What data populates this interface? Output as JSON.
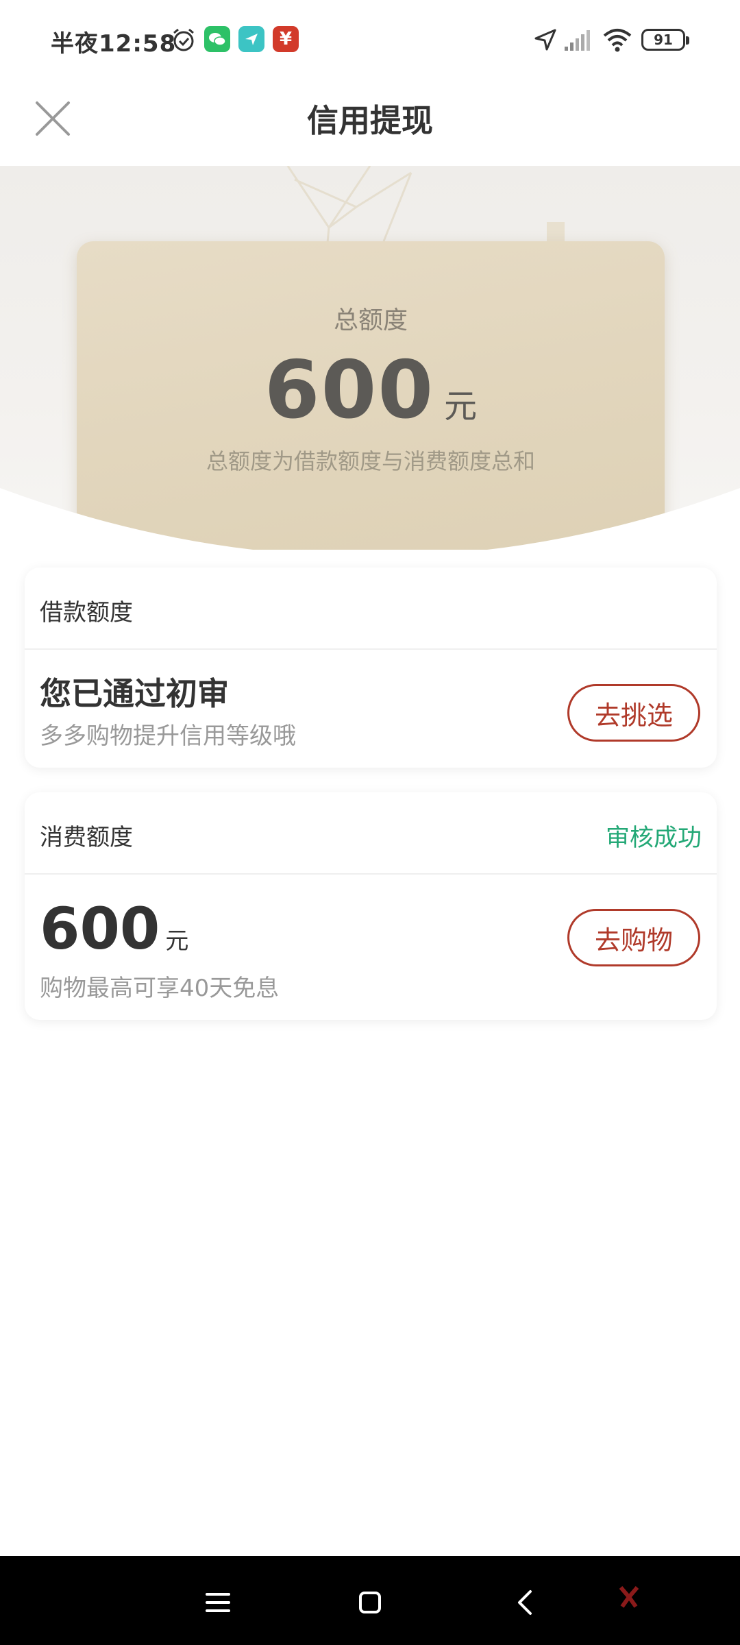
{
  "status_bar": {
    "time": "半夜12:58",
    "battery": "91",
    "icons": [
      "alarm-icon",
      "wechat-icon",
      "send-app-icon",
      "red-app-icon",
      "location-icon",
      "signal-icon",
      "wifi-icon",
      "battery-icon"
    ]
  },
  "header": {
    "title": "信用提现",
    "close_icon": "close-icon"
  },
  "hero": {
    "label": "总额度",
    "amount": "600",
    "unit": "元",
    "description": "总额度为借款额度与消费额度总和"
  },
  "loan_panel": {
    "title": "借款额度",
    "headline": "您已通过初审",
    "subtext": "多多购物提升信用等级哦",
    "button": "去挑选"
  },
  "consumption_panel": {
    "title": "消费额度",
    "status": "审核成功",
    "amount": "600",
    "unit": "元",
    "subtext": "购物最高可享40天免息",
    "button": "去购物"
  },
  "colors": {
    "accent_red": "#b03a2a",
    "success_green": "#23a876",
    "card_gold": "#e2d6bd"
  },
  "nav_bar": {
    "icons": [
      "menu-icon",
      "home-icon",
      "back-icon"
    ]
  }
}
